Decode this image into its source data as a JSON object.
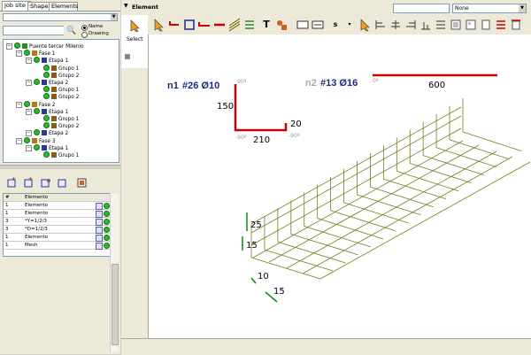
{
  "tabs": [
    "Job site",
    "Shapes",
    "Elements"
  ],
  "search": {
    "value": "",
    "radio_name": "Name",
    "radio_drawing": "Drawing"
  },
  "tree": [
    {
      "label": "Puente tercer Milenio",
      "level": 0,
      "type": "root"
    },
    {
      "label": "Fase 1",
      "level": 1,
      "type": "fase"
    },
    {
      "label": "Etapa 1",
      "level": 2,
      "type": "etapa"
    },
    {
      "label": "Grupo 1",
      "level": 3,
      "type": "grupo"
    },
    {
      "label": "Grupo 2",
      "level": 3,
      "type": "grupo"
    },
    {
      "label": "Etapa 2",
      "level": 2,
      "type": "etapa"
    },
    {
      "label": "Grupo 1",
      "level": 3,
      "type": "grupo"
    },
    {
      "label": "Grupo 2",
      "level": 3,
      "type": "grupo"
    },
    {
      "label": "Fase 2",
      "level": 1,
      "type": "fase"
    },
    {
      "label": "Etapa 1",
      "level": 2,
      "type": "etapa"
    },
    {
      "label": "Grupo 1",
      "level": 3,
      "type": "grupo"
    },
    {
      "label": "Grupo 2",
      "level": 3,
      "type": "grupo"
    },
    {
      "label": "Etapa 2",
      "level": 2,
      "type": "etapa"
    },
    {
      "label": "Fase 3",
      "level": 1,
      "type": "fase"
    },
    {
      "label": "Etapa 1",
      "level": 2,
      "type": "etapa"
    },
    {
      "label": "Grupo 1",
      "level": 3,
      "type": "grupo"
    }
  ],
  "table": {
    "headers": [
      "#",
      "Elemento"
    ],
    "rows": [
      {
        "n": "1",
        "name": "Elemento"
      },
      {
        "n": "1",
        "name": "Elemento"
      },
      {
        "n": "3",
        "name": "*Y=1/2/3"
      },
      {
        "n": "3",
        "name": "*D=1/2/3"
      },
      {
        "n": "1",
        "name": "Elemento"
      },
      {
        "n": "1",
        "name": "Mesh"
      }
    ]
  },
  "header": {
    "title": "Element",
    "dropdown_value": "None"
  },
  "toolbar": {
    "select_label": "Select",
    "text_tool": "T",
    "s_tool": "s"
  },
  "drawing": {
    "n1": {
      "label": "n1",
      "spec": "#26 Ø10",
      "dim_vertical": "150",
      "dim_horizontal": "210",
      "dim_end": "20",
      "angle_top": "90º",
      "angle_bottom_left": "-90º",
      "angle_bottom_right": "-90º"
    },
    "n2": {
      "label": "n2",
      "spec": "#13 Ø16",
      "dim": "600",
      "angle": "0º"
    },
    "mesh_dims": [
      "25",
      "15",
      "10",
      "15"
    ]
  },
  "colors": {
    "bar_red": "#cc0000",
    "label_blue": "#1a2a80",
    "mesh": "#7a7a1a",
    "dim_green": "#118811"
  }
}
